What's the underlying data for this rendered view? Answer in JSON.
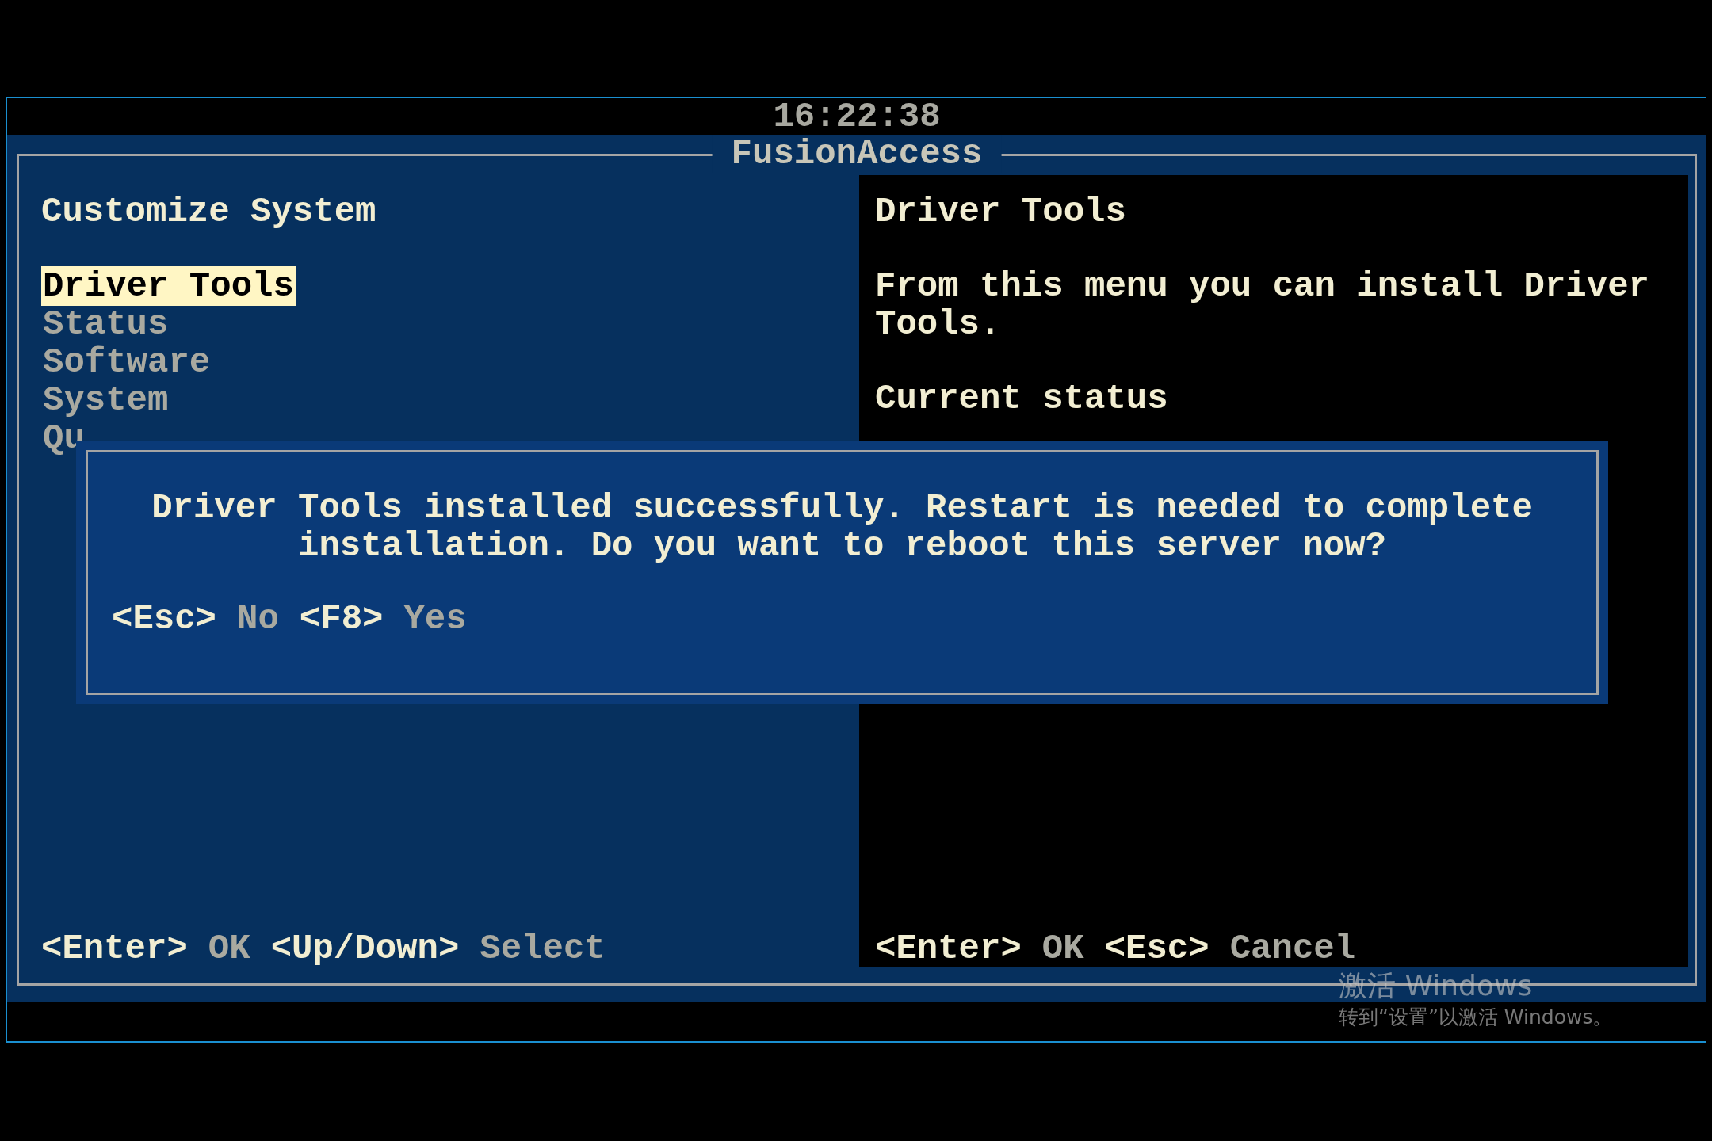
{
  "clock": "16:22:38",
  "title": "FusionAccess",
  "left_panel": {
    "heading": "Customize System",
    "menu_items": [
      {
        "label": "Driver Tools",
        "selected": true
      },
      {
        "label": "Status",
        "selected": false
      },
      {
        "label": "Software",
        "selected": false
      },
      {
        "label": "System",
        "selected": false
      },
      {
        "label": "Qu",
        "selected": false
      }
    ],
    "hints": [
      {
        "key": "<Enter>",
        "action": "OK"
      },
      {
        "key": "<Up/Down>",
        "action": "Select"
      }
    ]
  },
  "right_panel": {
    "heading": "Driver Tools",
    "description": "From this menu you can install Driver Tools.",
    "status_label": "Current status",
    "hints": [
      {
        "key": "<Enter>",
        "action": "OK"
      },
      {
        "key": "<Esc>",
        "action": "Cancel"
      }
    ]
  },
  "dialog": {
    "message": "Driver Tools installed successfully. Restart is needed to complete installation. Do you want to reboot this server now?",
    "hints": [
      {
        "key": "<Esc>",
        "action": "No"
      },
      {
        "key": "<F8>",
        "action": "Yes"
      }
    ]
  },
  "os_notice": {
    "title": "激活 Windows",
    "subtitle": "转到“设置”以激活 Windows。"
  }
}
